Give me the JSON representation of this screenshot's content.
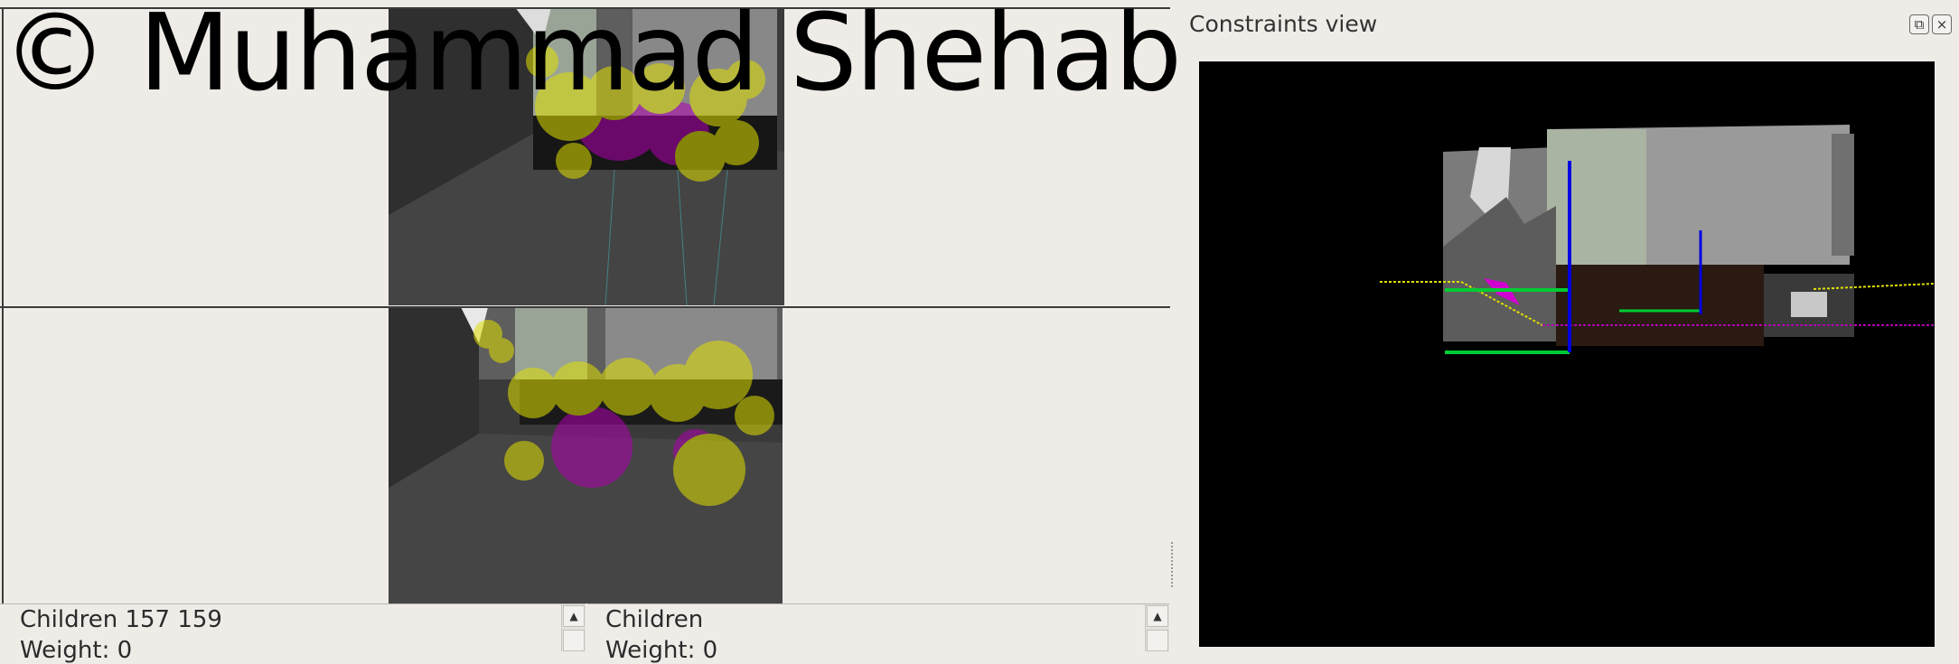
{
  "watermark": {
    "text": "© Muhammad Shehab"
  },
  "constraints_panel": {
    "title": "Constraints view",
    "float_icon": "float-icon",
    "close_icon": "close-icon",
    "float_glyph": "⧉",
    "close_glyph": "×"
  },
  "info_panels": [
    {
      "line1": "Children  157 159",
      "line2": "Weight: 0",
      "scroll_up_glyph": "▲"
    },
    {
      "line1": "Children",
      "line2": "Weight: 0",
      "scroll_up_glyph": "▲"
    }
  ],
  "colors": {
    "background": "#efece8",
    "viewport_black": "#000000",
    "feature_yellow": "#e0e000",
    "feature_magenta": "#b000b0",
    "axis_green": "#00cc33",
    "axis_blue": "#0000e0"
  }
}
